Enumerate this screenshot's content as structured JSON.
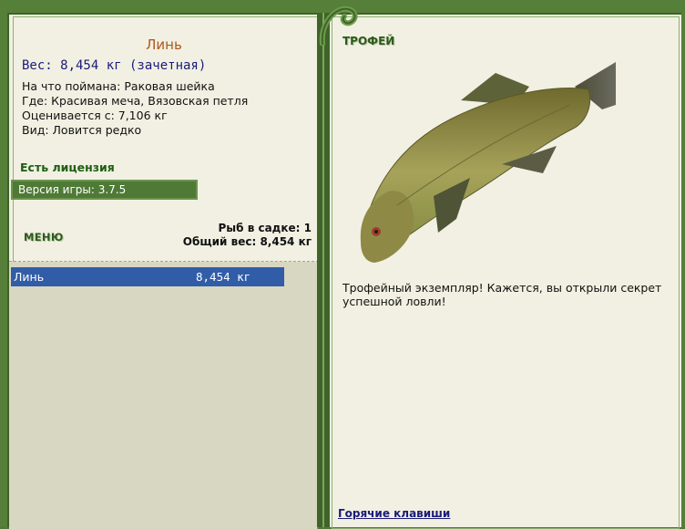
{
  "left": {
    "fish_name": "Линь",
    "weight_line": "Вес: 8,454 кг (зачетная)",
    "caught_on": "На что поймана: Раковая шейка",
    "where": "Где: Красивая меча, Вязовская петля",
    "valued": "Оценивается с: 7,106 кг",
    "kind": "Вид: Ловится редко",
    "license": "Есть лицензия",
    "version": "Версия игры: 3.7.5",
    "menu_label": "МЕНЮ",
    "keep_count": "Рыб в садке: 1",
    "total_weight": "Общий вес: 8,454 кг"
  },
  "fish_list": [
    {
      "name": "Линь",
      "weight": "8,454 кг"
    }
  ],
  "right": {
    "trophy_label": "ТРОФЕЙ",
    "description": "Трофейный экземпляр! Кажется, вы открыли секрет успешной ловли!",
    "hotkeys": "Горячие клавиши"
  },
  "colors": {
    "frame_green": "#567f3a",
    "panel_bg": "#f1f0e2",
    "selected_row": "#315da8",
    "title_orange": "#b0561b"
  },
  "icons": {
    "divider_ornament": "swirl-ornament-icon",
    "fish_picture": "tench-fish-image"
  }
}
